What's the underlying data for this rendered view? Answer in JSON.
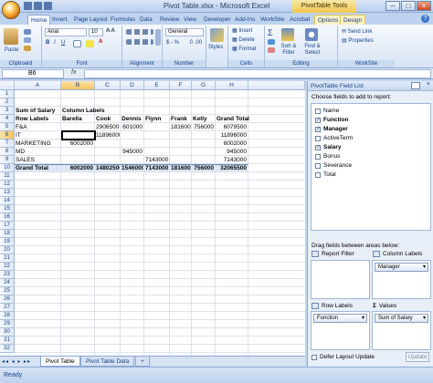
{
  "window": {
    "title": "Pivot Table.xlsx - Microsoft Excel",
    "context_tools": "PivotTable Tools"
  },
  "tabs": [
    "Home",
    "Insert",
    "Page Layout",
    "Formulas",
    "Data",
    "Review",
    "View",
    "Developer",
    "Add-Ins",
    "WorkSite",
    "Acrobat",
    "Options",
    "Design"
  ],
  "ribbon": {
    "groups": [
      "Clipboard",
      "Font",
      "Alignment",
      "Number",
      "Cells",
      "Editing",
      "WorkSite"
    ],
    "paste_label": "Paste",
    "font_name": "Arial",
    "font_size": "10",
    "number_format": "General",
    "styles_label": "Styles",
    "insert_label": "Insert",
    "delete_label": "Delete",
    "format_label": "Format",
    "sort_label": "Sort & Filter",
    "find_label": "Find & Select",
    "send_link_label": "Send Link",
    "properties_label": "Properties"
  },
  "formula_bar": {
    "name_box": "B6",
    "fx": "fx",
    "content": ""
  },
  "grid": {
    "columns": [
      "A",
      "B",
      "C",
      "D",
      "E",
      "F",
      "G",
      "H"
    ],
    "rows": [
      "1",
      "2",
      "3",
      "4",
      "5",
      "6",
      "7",
      "8",
      "9",
      "10",
      "11",
      "12",
      "13",
      "14",
      "15",
      "16",
      "17",
      "18",
      "19",
      "20",
      "21",
      "22",
      "23",
      "24",
      "25",
      "26",
      "27",
      "28",
      "29",
      "30",
      "31",
      "32"
    ],
    "cells": {
      "A3": "Sum of Salary",
      "B3": "Column Labels",
      "A4": "Row Labels",
      "B4": "Barella",
      "C4": "Cook",
      "D4": "Dennis",
      "E4": "Flynn",
      "F4": "Frank",
      "G4": "Kelly",
      "H4": "Grand Total",
      "A5": "F&A",
      "C5": "2906500",
      "D5": "601000",
      "F5": "1816000",
      "G5": "756000",
      "H5": "6079500",
      "A6": "IT",
      "C6": "11896000",
      "H6": "11896000",
      "A7": "MARKETING",
      "B7": "6002000",
      "H7": "6002000",
      "A8": "MD",
      "D8": "945000",
      "H8": "945000",
      "A9": "SALES",
      "E9": "7143000",
      "H9": "7143000",
      "A10": "Grand Total",
      "B10": "6002000",
      "C10": "14802500",
      "D10": "1546000",
      "E10": "7143000",
      "F10": "1816000",
      "G10": "756000",
      "H10": "32065500"
    }
  },
  "sheets": [
    "Pivot Table",
    "Pivot Table Data"
  ],
  "status": "Ready",
  "field_list": {
    "title": "PivotTable Field List",
    "choose_label": "Choose fields to add to report:",
    "fields": [
      {
        "name": "Name",
        "checked": false
      },
      {
        "name": "Function",
        "checked": true
      },
      {
        "name": "Manager",
        "checked": true
      },
      {
        "name": "ActiveTerm",
        "checked": false
      },
      {
        "name": "Salary",
        "checked": true
      },
      {
        "name": "Bonus",
        "checked": false
      },
      {
        "name": "Severance",
        "checked": false
      },
      {
        "name": "Total",
        "checked": false
      }
    ],
    "drag_label": "Drag fields between areas below:",
    "report_filter_label": "Report Filter",
    "column_labels_label": "Column Labels",
    "row_labels_label": "Row Labels",
    "values_label": "Values",
    "column_field": "Manager",
    "row_field": "Function",
    "value_field": "Sum of Salary",
    "defer_label": "Defer Layout Update",
    "update_label": "Update"
  }
}
